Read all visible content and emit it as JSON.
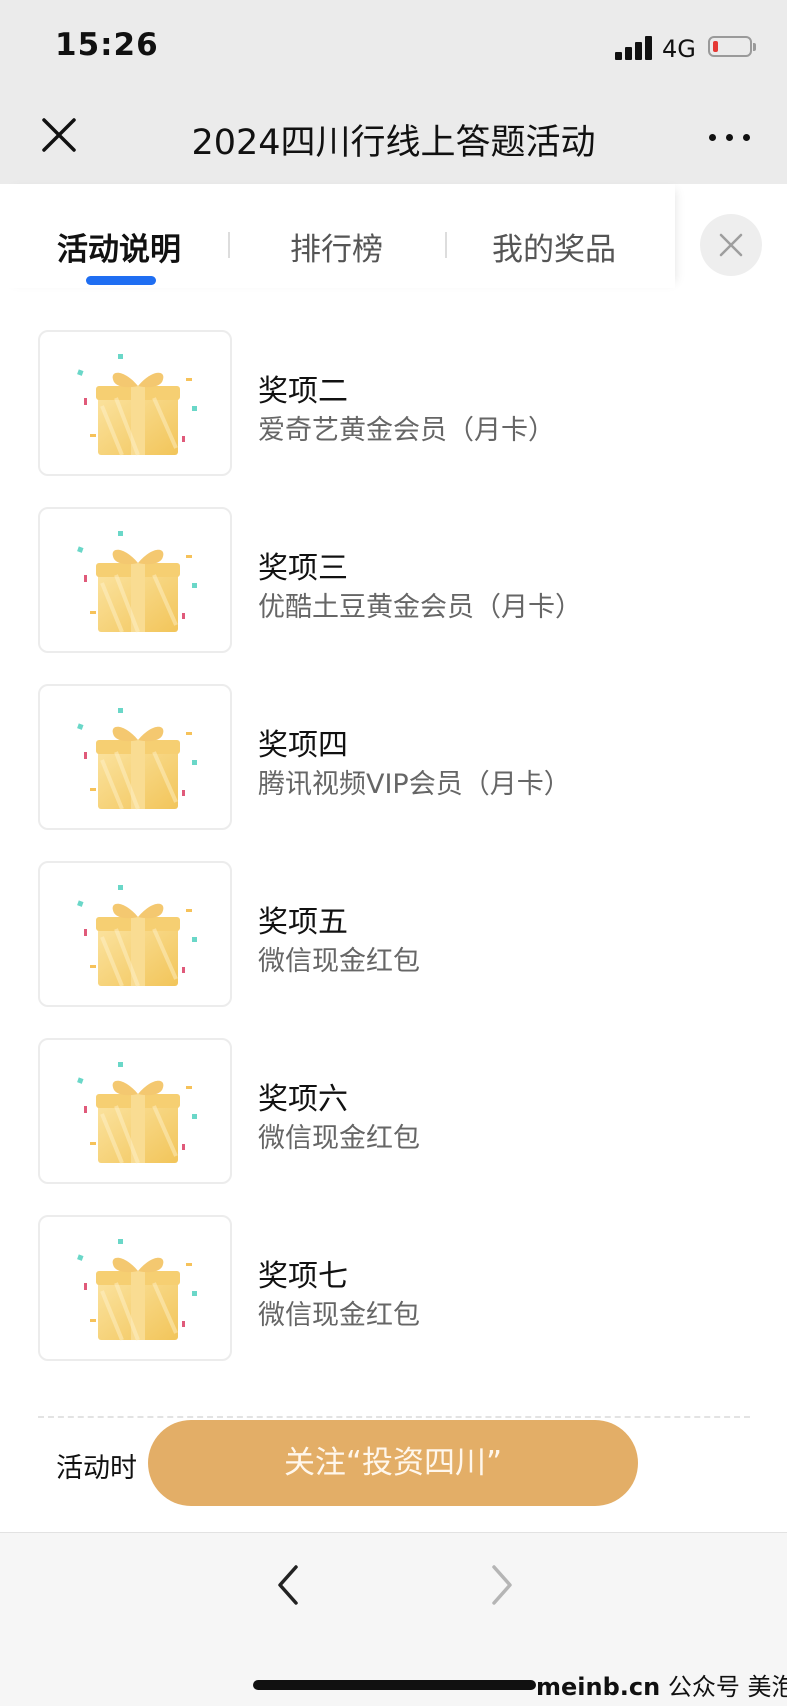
{
  "status": {
    "time": "15:26",
    "network": "4G"
  },
  "navbar": {
    "title": "2024四川行线上答题活动"
  },
  "tabs": [
    {
      "label": "活动说明",
      "active": true
    },
    {
      "label": "排行榜",
      "active": false
    },
    {
      "label": "我的奖品",
      "active": false
    }
  ],
  "prizes": [
    {
      "title": "奖项二",
      "desc": "爱奇艺黄金会员（月卡）"
    },
    {
      "title": "奖项三",
      "desc": "优酷土豆黄金会员（月卡）"
    },
    {
      "title": "奖项四",
      "desc": "腾讯视频VIP会员（月卡）"
    },
    {
      "title": "奖项五",
      "desc": "微信现金红包"
    },
    {
      "title": "奖项六",
      "desc": "微信现金红包"
    },
    {
      "title": "奖项七",
      "desc": "微信现金红包"
    }
  ],
  "activity_time_label": "活动时",
  "follow_button": "关注“投资四川”",
  "watermark": {
    "site": "meinb.cn",
    "account": "公众号 美泡君"
  },
  "colors": {
    "tab_accent": "#1f6ef2",
    "follow_button": "#e3ae67",
    "battery_low": "#e53935"
  }
}
